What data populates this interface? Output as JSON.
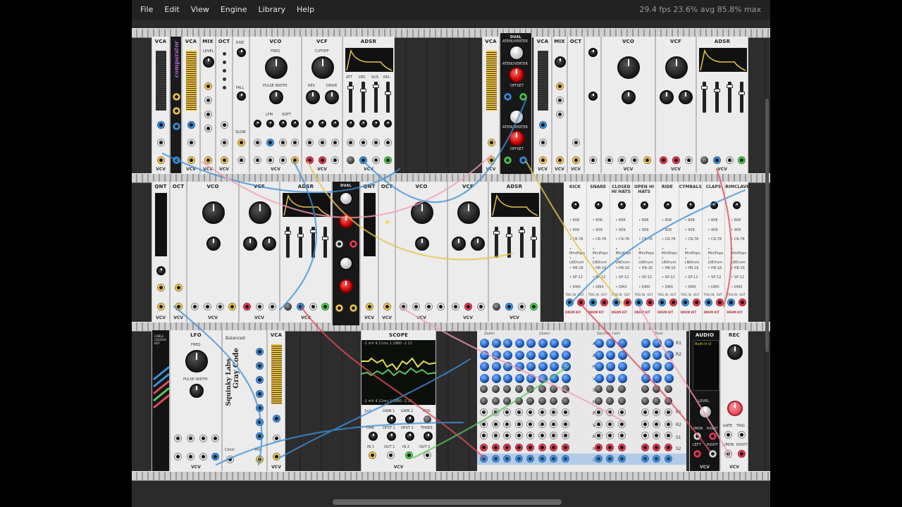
{
  "menubar": {
    "items": [
      "File",
      "Edit",
      "View",
      "Engine",
      "Library",
      "Help"
    ],
    "stats": "29.4 fps  23.6% avg  85.8% max"
  },
  "row1": {
    "modules": [
      "VCA",
      "VCA",
      "MIX",
      "OCT",
      "VCO",
      "VCF",
      "ADSR",
      "VCA",
      "VCA",
      "MIX",
      "OCT",
      "VCO",
      "VCF",
      "ADSR"
    ],
    "comparator_label": "comparator",
    "dual_attenuverter": [
      "DUAL",
      "ATENUVERTER",
      "ATENUVERTER",
      "OFFSET",
      "ATENUVERTER",
      "OFFSET",
      "IN",
      "OUT"
    ],
    "vco_labels": [
      "FREQ",
      "PULSE WIDTH",
      "LFM",
      "SOFT",
      "FM",
      "V/OCT",
      "SYNC",
      "PWM",
      "SIN",
      "TRI",
      "SAW",
      "SQR"
    ],
    "vcf_labels": [
      "CUTOFF",
      "RES",
      "DRIVE",
      "CUT",
      "RES",
      "DRIVE",
      "IN",
      "LPF",
      "HPF"
    ],
    "adsr_labels": [
      "ATT",
      "DEC",
      "SUS",
      "REL",
      "PUSH",
      "GATE",
      "RETR",
      "ENV"
    ],
    "slew_labels": [
      "RISE",
      "FALL",
      "SLOW"
    ],
    "mix_labels": [
      "LEVEL",
      "IN",
      "MIX",
      "OUT"
    ]
  },
  "row2": {
    "modules": [
      "QNT",
      "OCT",
      "VCO",
      "VCF",
      "ADSR",
      "QNT",
      "OCT",
      "VCO",
      "VCF",
      "ADSR"
    ],
    "drum_columns": [
      "KICK",
      "SNARE",
      "CLOSED HI HATS",
      "OPEN HI HATS",
      "RIDE",
      "CYMBALS",
      "CLAPS",
      "RIMCLAVES"
    ],
    "drum_kits": [
      "808",
      "909",
      "CR-78",
      "MiniPops",
      "LNDrum",
      "HR-16",
      "SP-12",
      "DMX"
    ],
    "drum_footer": [
      "TRIG IN",
      "OUT"
    ],
    "drum_badge": "DRUM KIT"
  },
  "row3": {
    "cable_colour_key": "CABLE COLOUR KEY",
    "lfo": {
      "title": "LFO",
      "labels": [
        "FREQ",
        "PULSE WIDTH",
        "INV",
        "OFST",
        "FM",
        "CLK",
        "RESET",
        "PWM",
        "SIN",
        "TRI",
        "SAW",
        "SQR"
      ]
    },
    "gray_code": {
      "title": "Balanced",
      "brand": "Squinky Labs",
      "name": "Gray Code",
      "clock": "Clock",
      "mix": "Mix"
    },
    "vca": "VCA",
    "scope": {
      "title": "SCOPE",
      "readout1": "-2 mV  4.11ms  1 18B0  -2.12",
      "readout2": "-2 mV  4.11ms  1 18B0  -2.12",
      "labels": [
        "1x2",
        "GAIN 1",
        "GAIN 2",
        "TRIG",
        "TIME",
        "OFST 1",
        "OFST 2",
        "THRES",
        "IN 1",
        "OUT 1",
        "IN 2",
        "OUT 2"
      ]
    },
    "mixer_headers": [
      "Zazen",
      "Zazen",
      "Squinky Labs",
      "Tone"
    ],
    "mixer_rows": [
      "AX1",
      "AX2",
      "Pan",
      "Vol",
      "S",
      "M",
      "Pan",
      "Vol",
      "M",
      "In",
      "Out"
    ],
    "mixer_right": [
      "R1",
      "R2",
      "R1",
      "R2",
      "S1",
      "S2"
    ],
    "audio": {
      "title": "AUDIO",
      "device": "Built-in O",
      "level": "LEVEL",
      "labels": [
        "L/MON",
        "RIGHT",
        "LEFT",
        "RIGHT"
      ]
    },
    "rec": {
      "title": "REC",
      "labels": [
        "GATE",
        "TRIG",
        "L/MON",
        "RIGHT"
      ]
    }
  },
  "footer_brand": "VCV",
  "colors": {
    "cable_blue": "#3d8fd6",
    "cable_red": "#e04a5a",
    "cable_yellow": "#e5c44a",
    "cable_green": "#5ec45e",
    "cable_pink": "#f39fb0"
  }
}
